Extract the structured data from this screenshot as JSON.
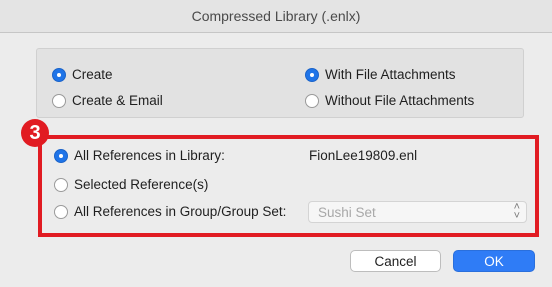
{
  "window": {
    "title": "Compressed Library (.enlx)"
  },
  "action_options": {
    "create": {
      "label": "Create",
      "selected": true
    },
    "create_email": {
      "label": "Create & Email",
      "selected": false
    }
  },
  "attachment_options": {
    "with": {
      "label": "With File Attachments",
      "selected": true
    },
    "without": {
      "label": "Without File Attachments",
      "selected": false
    }
  },
  "annotation": {
    "step_number": "3",
    "highlight_color": "#e11b22"
  },
  "scope_options": {
    "all_library": {
      "label": "All References in Library:",
      "selected": true
    },
    "selected_refs": {
      "label": "Selected Reference(s)",
      "selected": false
    },
    "group_set": {
      "label": "All References in Group/Group Set:",
      "selected": false
    }
  },
  "filename": "FionLee19809.enl",
  "group_select": {
    "value": "Sushi Set",
    "enabled": false
  },
  "buttons": {
    "cancel": "Cancel",
    "ok": "OK"
  },
  "colors": {
    "accent": "#1f74e8",
    "ok_button": "#2f7cf6"
  }
}
